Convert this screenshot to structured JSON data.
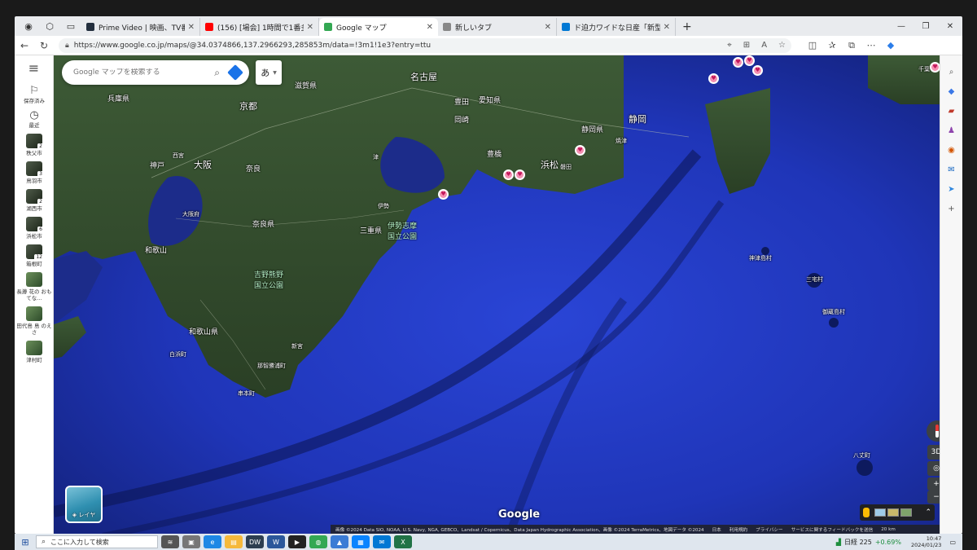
{
  "browser": {
    "tabs": [
      {
        "label": "Prime Video | 映画、TV番組、ライ",
        "color": "#232f3e"
      },
      {
        "label": "(156) [場会] 1時間で1番多くカロリ",
        "color": "#ff0000"
      },
      {
        "label": "Google マップ",
        "color": "#34a853",
        "active": true
      },
      {
        "label": "新しいタブ",
        "color": "#888888"
      },
      {
        "label": "ド迫力ワイドな日産「新型GT-R」初",
        "color": "#0078d4"
      }
    ],
    "new_tab": "+",
    "url": "https://www.google.co.jp/maps/@34.0374866,137.2966293,285853m/data=!3m1!1e3?entry=ttu"
  },
  "maps": {
    "search_placeholder": "Google マップを検索する",
    "ime_mode": "あ",
    "rail": {
      "saved": "保存済み",
      "recent": "最近",
      "recent_items": [
        {
          "label": "秩父市",
          "badge": "2"
        },
        {
          "label": "鳥羽市",
          "badge": "3"
        },
        {
          "label": "湖西市",
          "badge": "2"
        },
        {
          "label": "浜松市",
          "badge": "6"
        },
        {
          "label": "箱根町",
          "badge": "12"
        },
        {
          "label": "長瀞 花の おもてな…",
          "badge": ""
        },
        {
          "label": "田代島 島 のえさ",
          "badge": ""
        },
        {
          "label": "津村町",
          "badge": ""
        }
      ]
    },
    "labels": {
      "nagoya": "名古屋",
      "toyota": "豊田",
      "aichi": "愛知県",
      "okazaki": "岡崎",
      "toyohashi": "豊橋",
      "hamamatsu": "浜松",
      "shizuoka_pref": "静岡県",
      "shizuoka": "静岡",
      "iwata": "磐田",
      "yaizu": "焼津",
      "kyoto": "京都",
      "shiga": "滋賀県",
      "hyogo": "兵庫県",
      "osaka": "大阪",
      "osaka_pref": "大阪府",
      "kobe": "神戸",
      "nishinomiya": "西宮",
      "nara": "奈良",
      "nara_pref": "奈良県",
      "wakayama": "和歌山",
      "wakayama_pref": "和歌山県",
      "mie": "三重県",
      "ise": "伊勢",
      "tsu": "津",
      "ise_park": "伊勢志摩\n国立公園",
      "yoshino_park": "吉野熊野\n国立公園",
      "shirahama": "白浜町",
      "nachi": "那智勝浦町",
      "shingu": "新宮",
      "kushimoto": "串本町",
      "kozushima": "神津島村",
      "miyake": "三宅村",
      "mikura": "御蔵島村",
      "hachijo": "八丈町",
      "chiba": "千葉"
    },
    "layers": "レイヤ",
    "control_3d": "3D",
    "zoom_in": "+",
    "zoom_out": "−",
    "logo": "Google",
    "attribution": [
      "画像 ©2024 Data SIO, NOAA, U.S. Navy, NGA, GEBCO、Landsat / Copernicus、Data Japan Hydrographic Association、画像 ©2024 TerraMetrics、地図データ ©2024",
      "日本",
      "利用規約",
      "プライバシー",
      "サービスに関するフィードバックを送信",
      "20 km"
    ]
  },
  "taskbar": {
    "search_placeholder": "ここに入力して検索",
    "nikkei": "日経 225",
    "nikkei_change": "+0.69%",
    "time": "10:47",
    "date": "2024/01/23"
  }
}
